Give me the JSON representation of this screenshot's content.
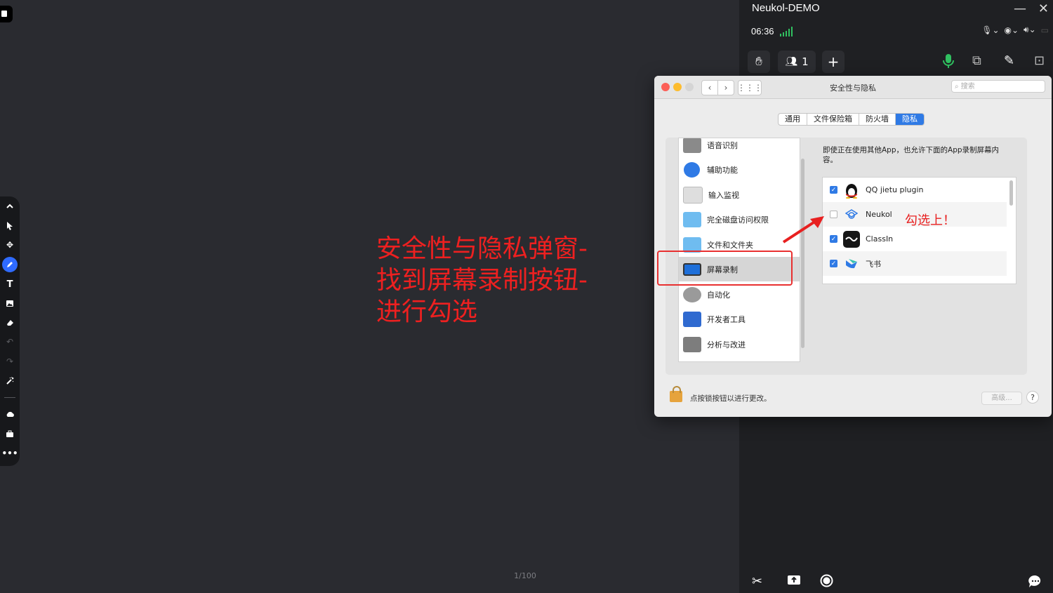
{
  "annotation": {
    "instruction_lines": [
      "安全性与隐私弹窗-",
      "找到屏幕录制按钮-",
      "进行勾选"
    ],
    "check_note": "勾选上！",
    "color": "#ee2020"
  },
  "canvas": {
    "page_counter": "1/100"
  },
  "left_toolbar": {
    "tools": [
      "collapse-up-icon",
      "pointer-icon",
      "move-icon",
      "pen-icon",
      "text-icon",
      "image-icon",
      "eraser-icon",
      "undo-icon",
      "redo-icon",
      "magic-wand-icon",
      "cloud-icon",
      "toolbox-icon",
      "more-icon"
    ],
    "active_tool": "pen-icon"
  },
  "right_panel": {
    "title": "Neukol-DEMO",
    "clock": "06:36",
    "participants_count": "1",
    "media_icons": [
      "mic-icon",
      "camera-icon",
      "speaker-icon"
    ],
    "top_buttons": [
      "raise-hand-icon",
      "participants-icon",
      "add-icon",
      "mic-active-icon",
      "screen-share-icon",
      "annotate-icon",
      "screenshot-icon"
    ],
    "bottom_buttons": [
      "scissors-icon",
      "upload-icon",
      "record-icon",
      "chat-icon"
    ],
    "accent": "#30c060"
  },
  "dialog": {
    "title": "安全性与隐私",
    "search_placeholder": "搜索",
    "tabs": [
      {
        "label": "通用",
        "selected": false
      },
      {
        "label": "文件保险箱",
        "selected": false
      },
      {
        "label": "防火墙",
        "selected": false
      },
      {
        "label": "隐私",
        "selected": true
      }
    ],
    "categories": [
      {
        "label": "语音识别",
        "icon": "waveform-icon"
      },
      {
        "label": "辅助功能",
        "icon": "accessibility-icon"
      },
      {
        "label": "输入监视",
        "icon": "keyboard-icon"
      },
      {
        "label": "完全磁盘访问权限",
        "icon": "folder-icon"
      },
      {
        "label": "文件和文件夹",
        "icon": "folder-icon"
      },
      {
        "label": "屏幕录制",
        "icon": "display-icon",
        "selected": true
      },
      {
        "label": "自动化",
        "icon": "gear-icon"
      },
      {
        "label": "开发者工具",
        "icon": "developer-tools-icon"
      },
      {
        "label": "分析与改进",
        "icon": "chart-icon"
      }
    ],
    "description": "即使正在使用其他App，也允许下面的App录制屏幕内容。",
    "apps": [
      {
        "name": "QQ jietu plugin",
        "checked": true,
        "icon": "qq-penguin-icon"
      },
      {
        "name": "Neukol",
        "checked": false,
        "icon": "neukol-icon"
      },
      {
        "name": "ClassIn",
        "checked": true,
        "icon": "classin-icon"
      },
      {
        "name": "飞书",
        "checked": true,
        "icon": "feishu-icon"
      }
    ],
    "lock_text": "点按锁按钮以进行更改。",
    "advanced_label": "高级...",
    "help_label": "?"
  }
}
